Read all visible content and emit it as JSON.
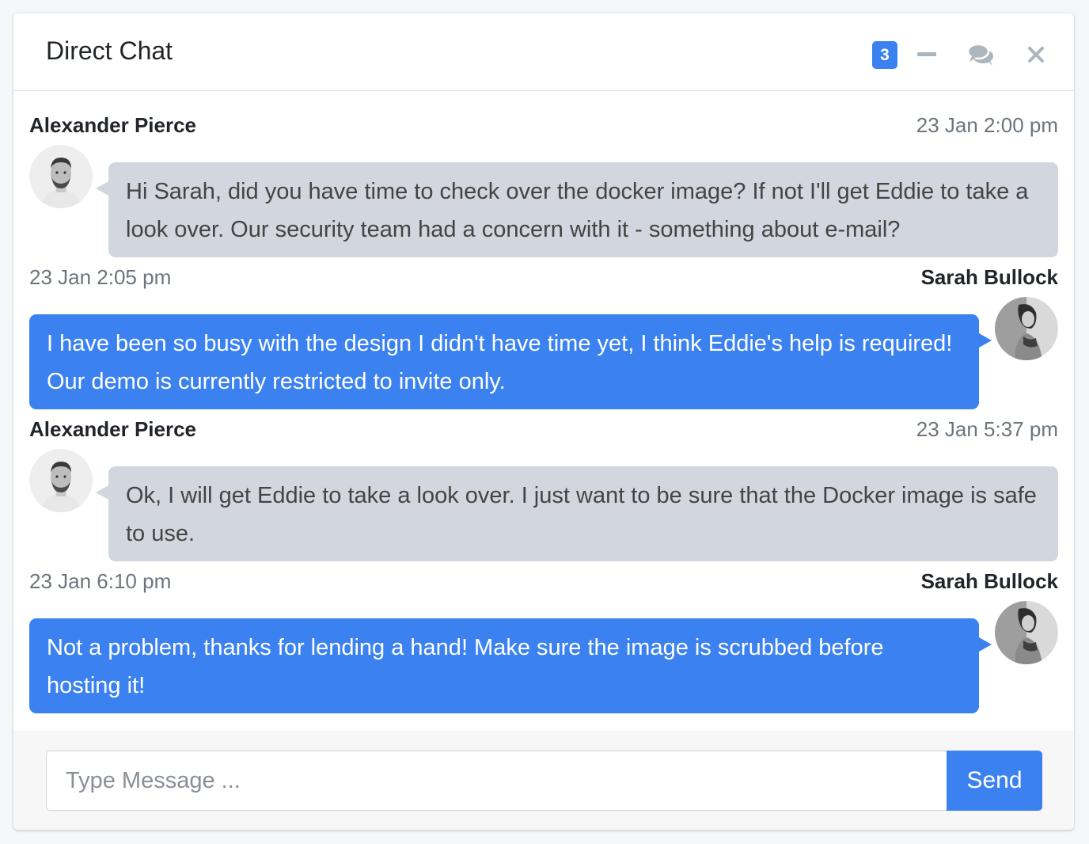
{
  "header": {
    "title": "Direct Chat",
    "badge_count": "3",
    "tools": [
      {
        "name": "minus-icon"
      },
      {
        "name": "comments-icon"
      },
      {
        "name": "close-icon"
      }
    ]
  },
  "messages": [
    {
      "side": "left",
      "name": "Alexander Pierce",
      "time": "23 Jan 2:00 pm",
      "text": "Hi Sarah, did you have time to check over the docker image? If not I'll get Eddie to take a look over. Our security team had a concern with it - something about e-mail?"
    },
    {
      "side": "right",
      "name": "Sarah Bullock",
      "time": "23 Jan 2:05 pm",
      "text": "I have been so busy with the design I didn't have time yet, I think Eddie's help is required! Our demo is currently restricted to invite only."
    },
    {
      "side": "left",
      "name": "Alexander Pierce",
      "time": "23 Jan 5:37 pm",
      "text": "Ok, I will get Eddie to take a look over. I just want to be sure that the Docker image is safe to use."
    },
    {
      "side": "right",
      "name": "Sarah Bullock",
      "time": "23 Jan 6:10 pm",
      "text": "Not a problem, thanks for lending a hand! Make sure the image is scrubbed before hosting it!"
    }
  ],
  "footer": {
    "input_placeholder": "Type Message ...",
    "input_value": "",
    "send_label": "Send"
  },
  "colors": {
    "primary": "#3b82f0",
    "bubble_left": "#d2d6de",
    "muted_text": "#6c757d"
  }
}
